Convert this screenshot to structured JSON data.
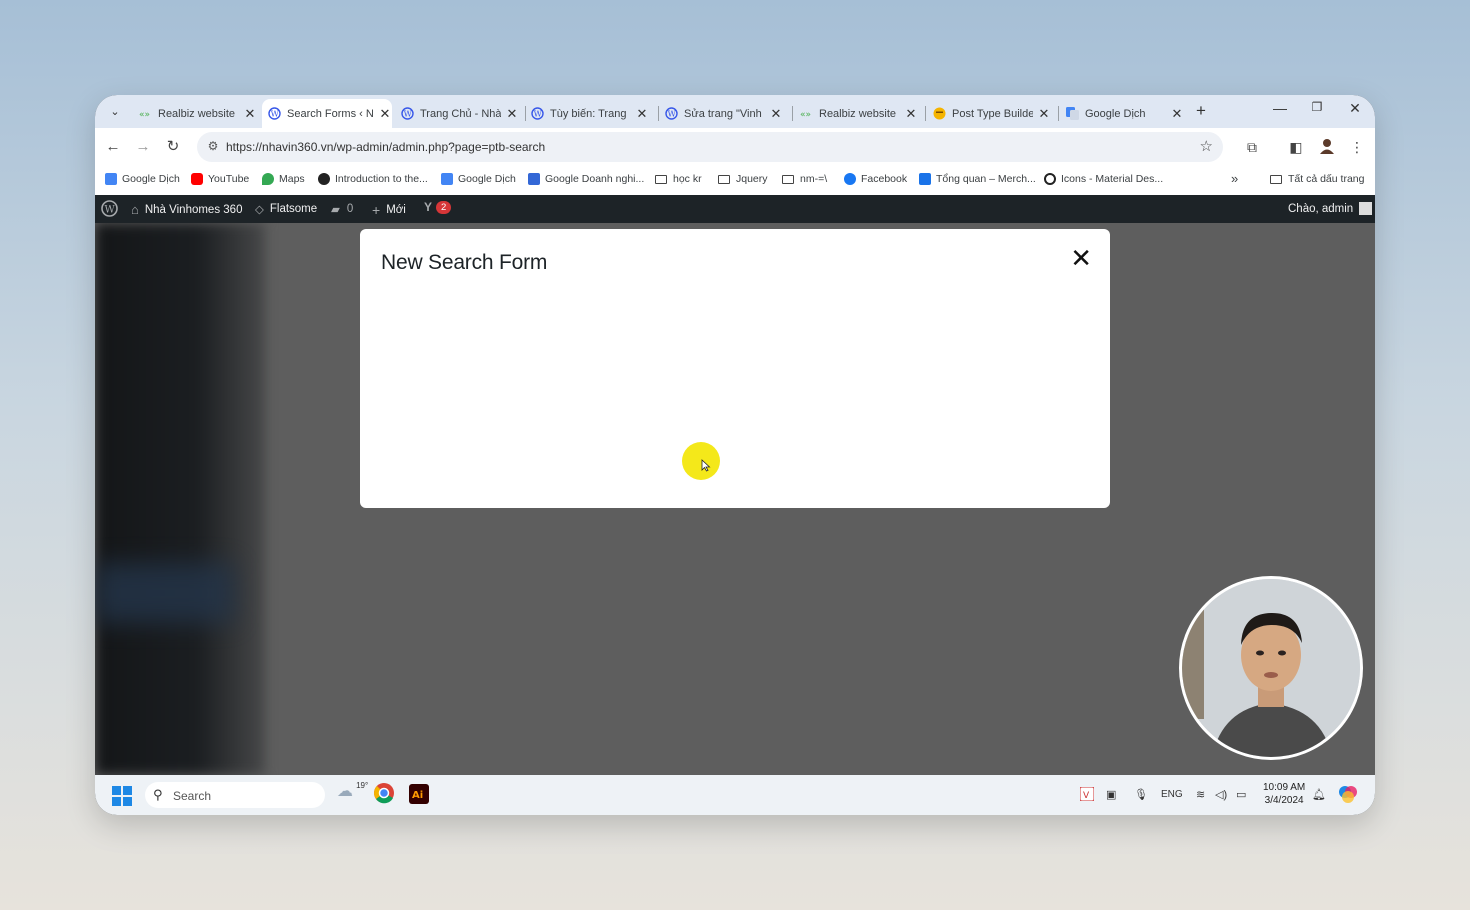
{
  "browser": {
    "tabs": [
      {
        "label": "Realbiz website",
        "icon": "realbiz-icon",
        "active": false
      },
      {
        "label": "Search Forms ‹ N",
        "icon": "wordpress-icon",
        "active": true
      },
      {
        "label": "Trang Chủ - Nhà",
        "icon": "wordpress-icon",
        "active": false
      },
      {
        "label": "Tùy biến: Trang",
        "icon": "wordpress-icon",
        "active": false
      },
      {
        "label": "Sửa trang \"Vinh",
        "icon": "wordpress-icon",
        "active": false
      },
      {
        "label": "Realbiz website",
        "icon": "realbiz-icon",
        "active": false
      },
      {
        "label": "Post Type Builde",
        "icon": "emoji-icon",
        "active": false
      },
      {
        "label": "Google Dịch",
        "icon": "google-translate-icon",
        "active": false
      }
    ],
    "url": "https://nhavin360.vn/wp-admin/admin.php?page=ptb-search",
    "bookmarks": [
      {
        "label": "Google Dịch",
        "icon": "google-translate-icon"
      },
      {
        "label": "YouTube",
        "icon": "youtube-icon"
      },
      {
        "label": "Maps",
        "icon": "maps-icon"
      },
      {
        "label": "Introduction to the...",
        "icon": "circle-icon"
      },
      {
        "label": "Google Dịch",
        "icon": "google-translate-icon"
      },
      {
        "label": "Google Doanh nghi...",
        "icon": "business-icon"
      },
      {
        "label": "học kr",
        "icon": "folder-icon"
      },
      {
        "label": "Jquery",
        "icon": "folder-icon"
      },
      {
        "label": "nm-=\\",
        "icon": "folder-icon"
      },
      {
        "label": "Facebook",
        "icon": "facebook-icon"
      },
      {
        "label": "Tổng quan – Merch...",
        "icon": "merchant-icon"
      },
      {
        "label": "Icons - Material Des...",
        "icon": "github-icon"
      }
    ],
    "all_bookmarks": "Tất cả dấu trang"
  },
  "wp_admin_bar": {
    "site_name": "Nhà Vinhomes 360",
    "theme": "Flatsome",
    "comments_count": "0",
    "new_label": "Mới",
    "yoast_count": "2",
    "greeting": "Chào, admin"
  },
  "modal": {
    "title": "New Search Form"
  },
  "taskbar": {
    "search_placeholder": "Search",
    "weather": "19°",
    "language": "ENG",
    "time": "10:09 AM",
    "date": "3/4/2024"
  },
  "colors": {
    "tab_strip": "#dfe7f3",
    "wp_admin_bar": "#1d2327",
    "overlay": "#5e5e5e",
    "badge": "#d63638",
    "cursor_highlight": "#f4e81a"
  }
}
